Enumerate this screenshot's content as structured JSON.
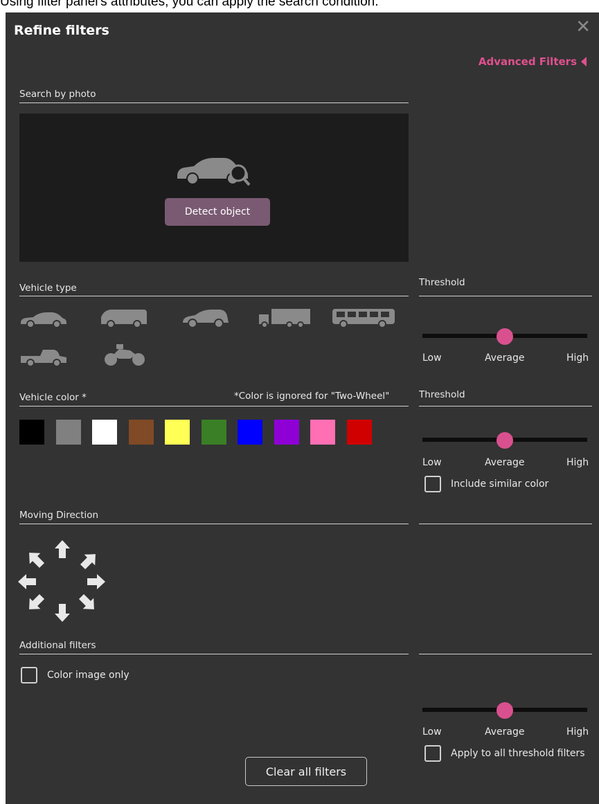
{
  "caption": "Using filter panel's attributes, you can apply the search condition.",
  "header": {
    "title": "Refine filters",
    "close_icon": "close-icon",
    "advanced_label": "Advanced Filters"
  },
  "search_by_photo": {
    "label": "Search by photo",
    "icon": "car-search-icon",
    "detect_button": "Detect object"
  },
  "vehicle_type": {
    "label": "Vehicle type",
    "threshold_label": "Threshold",
    "types": [
      "sedan-icon",
      "van-icon",
      "hatchback-icon",
      "truck-icon",
      "bus-icon",
      "pickup-icon",
      "motorcycle-icon"
    ],
    "slider": {
      "value": 0.5,
      "low": "Low",
      "mid": "Average",
      "high": "High"
    }
  },
  "vehicle_color": {
    "label": "Vehicle color *",
    "note": "*Color is ignored for \"Two-Wheel\"",
    "threshold_label": "Threshold",
    "colors": [
      "#000000",
      "#808080",
      "#ffffff",
      "#7f4a25",
      "#ffff55",
      "#3a7f25",
      "#0000ff",
      "#8f00d6",
      "#ff6fb3",
      "#d10000"
    ],
    "slider": {
      "value": 0.5,
      "low": "Low",
      "mid": "Average",
      "high": "High"
    },
    "similar_color_label": "Include similar color"
  },
  "moving_direction": {
    "label": "Moving Direction",
    "directions": [
      "north",
      "north-east",
      "east",
      "south-east",
      "south",
      "south-west",
      "west",
      "north-west"
    ]
  },
  "additional_filters": {
    "label": "Additional filters",
    "color_image_only_label": "Color image only",
    "slider": {
      "value": 0.5,
      "low": "Low",
      "mid": "Average",
      "high": "High"
    },
    "apply_all_label": "Apply to all threshold filters"
  },
  "footer": {
    "clear_button": "Clear all filters"
  },
  "colors": {
    "panel_bg": "#333333",
    "accent": "#e0508e",
    "button": "#7a5a72"
  }
}
